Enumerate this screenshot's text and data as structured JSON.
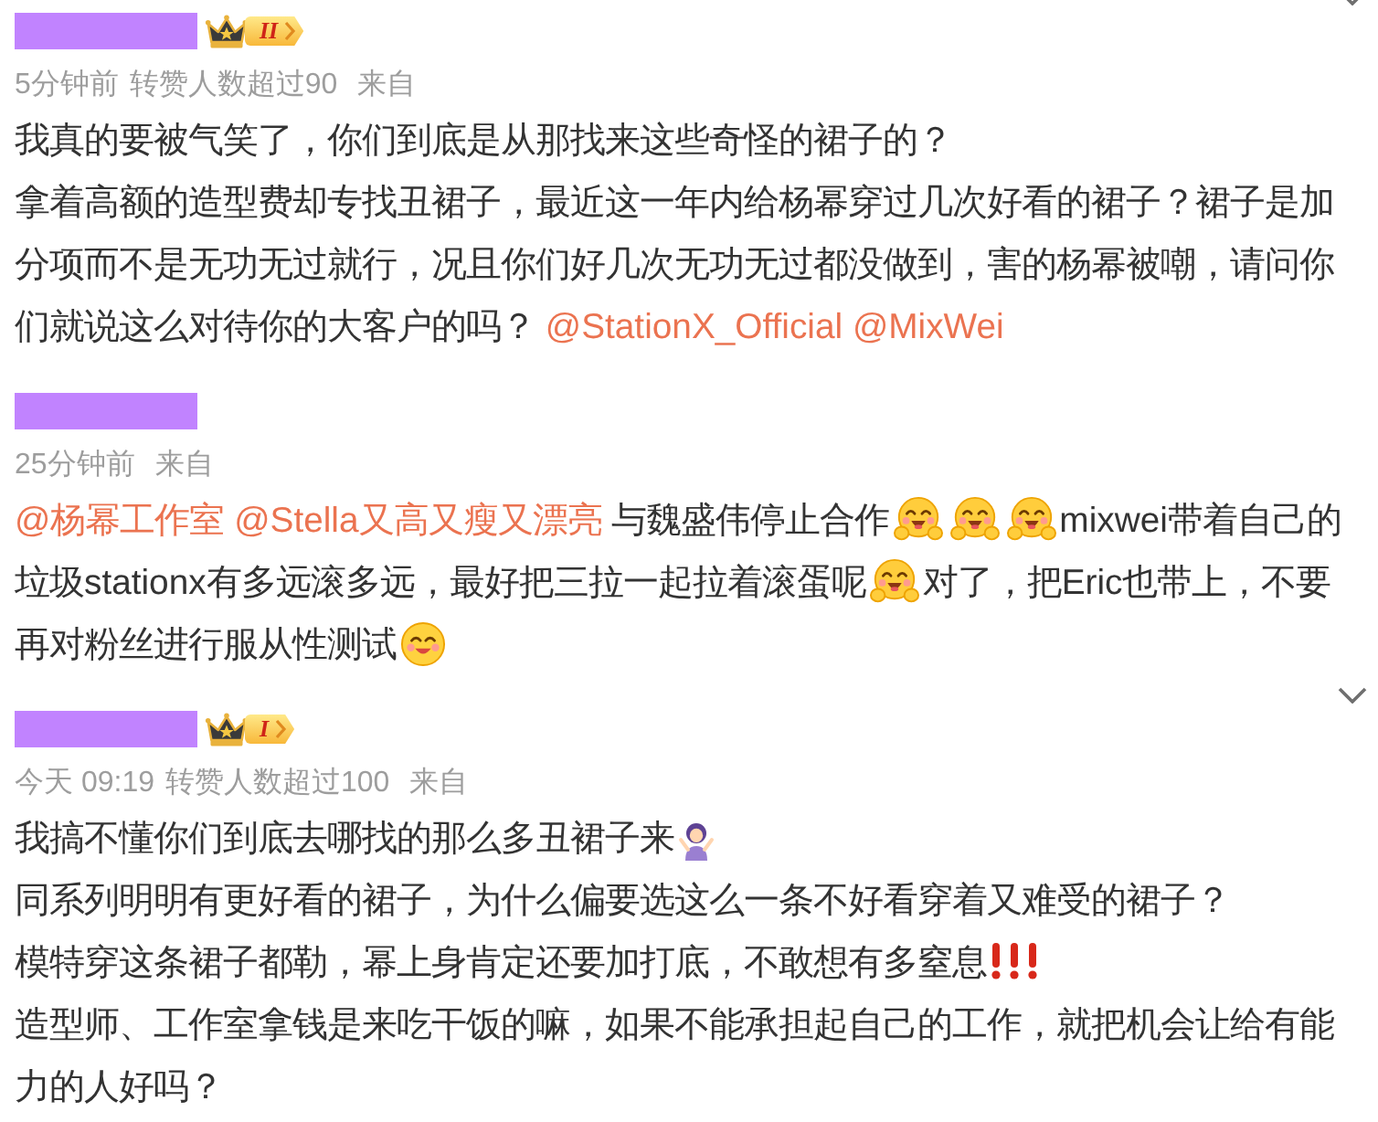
{
  "comments": [
    {
      "badge": {
        "level": "II"
      },
      "menu_button": true,
      "meta": {
        "time": "5分钟前",
        "stat": "转赞人数超过90",
        "source": "来自"
      },
      "paragraphs": [
        {
          "parts": [
            {
              "kind": "text",
              "text": "我真的要被气笑了，你们到底是从那找来这些奇怪的裙子的？"
            }
          ]
        },
        {
          "parts": [
            {
              "kind": "text",
              "text": "拿着高额的造型费却专找丑裙子，最近这一年内给杨幂穿过几次好看的裙子？裙子是加分项而不是无功无过就行，况且你们好几次无功无过都没做到，害的杨幂被嘲，请问你们就说这么对待你的大客户的吗？ "
            },
            {
              "kind": "mention",
              "text": "@StationX_Official"
            },
            {
              "kind": "mention",
              "text": "@MixWei"
            }
          ]
        }
      ]
    },
    {
      "menu_button": false,
      "meta": {
        "time": "25分钟前",
        "source": "来自"
      },
      "paragraphs": [
        {
          "parts": [
            {
              "kind": "mention",
              "text": "@杨幂工作室"
            },
            {
              "kind": "mention",
              "text": "@Stella又高又瘦又漂亮"
            },
            {
              "kind": "text",
              "text": " 与魏盛伟停止合作"
            },
            {
              "kind": "hug"
            },
            {
              "kind": "hug"
            },
            {
              "kind": "hug"
            },
            {
              "kind": "text",
              "text": "mixwei带着自己的垃圾stationx有多远滚多远，最好把三拉一起拉着滚蛋呢"
            },
            {
              "kind": "hug"
            },
            {
              "kind": "text",
              "text": "对了，把Eric也带上，不要再对粉丝进行服从性测试"
            },
            {
              "kind": "smile"
            }
          ]
        }
      ]
    },
    {
      "badge": {
        "level": "I"
      },
      "menu_button": true,
      "meta": {
        "time": "今天 09:19",
        "stat": "转赞人数超过100",
        "source": "来自"
      },
      "paragraphs": [
        {
          "parts": [
            {
              "kind": "text",
              "text": "我搞不懂你们到底去哪找的那么多丑裙子来"
            },
            {
              "kind": "shrug"
            }
          ]
        },
        {
          "parts": [
            {
              "kind": "text",
              "text": "同系列明明有更好看的裙子，为什么偏要选这么一条不好看穿着又难受的裙子？"
            }
          ]
        },
        {
          "parts": [
            {
              "kind": "text",
              "text": "模特穿这条裙子都勒，幂上身肯定还要加打底，不敢想有多窒息"
            },
            {
              "kind": "exclaim"
            },
            {
              "kind": "exclaim"
            },
            {
              "kind": "exclaim"
            }
          ]
        },
        {
          "parts": [
            {
              "kind": "text",
              "text": "造型师、工作室拿钱是来吃干饭的嘛，如果不能承担起自己的工作，就把机会让给有能力的人好吗？"
            }
          ]
        }
      ]
    }
  ]
}
